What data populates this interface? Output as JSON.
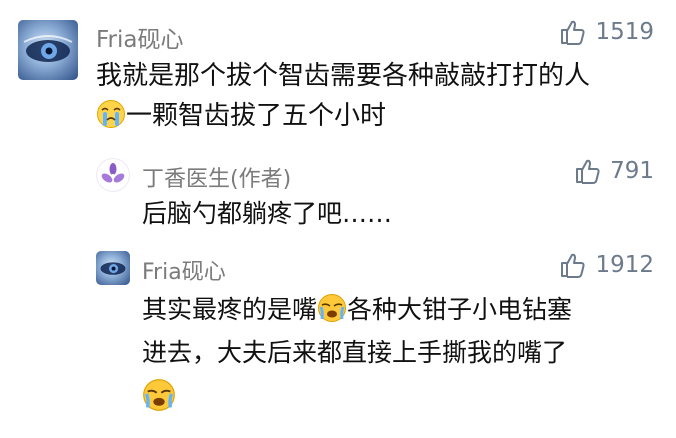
{
  "comments": [
    {
      "username": "Fria砚心",
      "likes": "1519",
      "line1": "我就是那个拔个智齿需要各种敲敲打打的人",
      "line2_after_emoji": "一颗智齿拔了五个小时",
      "emoji": "crying-face-emoji"
    },
    {
      "username": "丁香医生(作者)",
      "likes": "791",
      "line1": "后脑勺都躺疼了吧……"
    },
    {
      "username": "Fria砚心",
      "likes": "1912",
      "line1_before_emoji": "其实最疼的是嘴",
      "line1_after_emoji": "各种大钳子小电钻塞",
      "line2": "进去，大夫后来都直接上手撕我的嘴了",
      "emoji": "sobbing-face-emoji"
    }
  ],
  "colors": {
    "username": "#7b7b7b",
    "likes": "#6c7a8c",
    "text": "#111111"
  }
}
